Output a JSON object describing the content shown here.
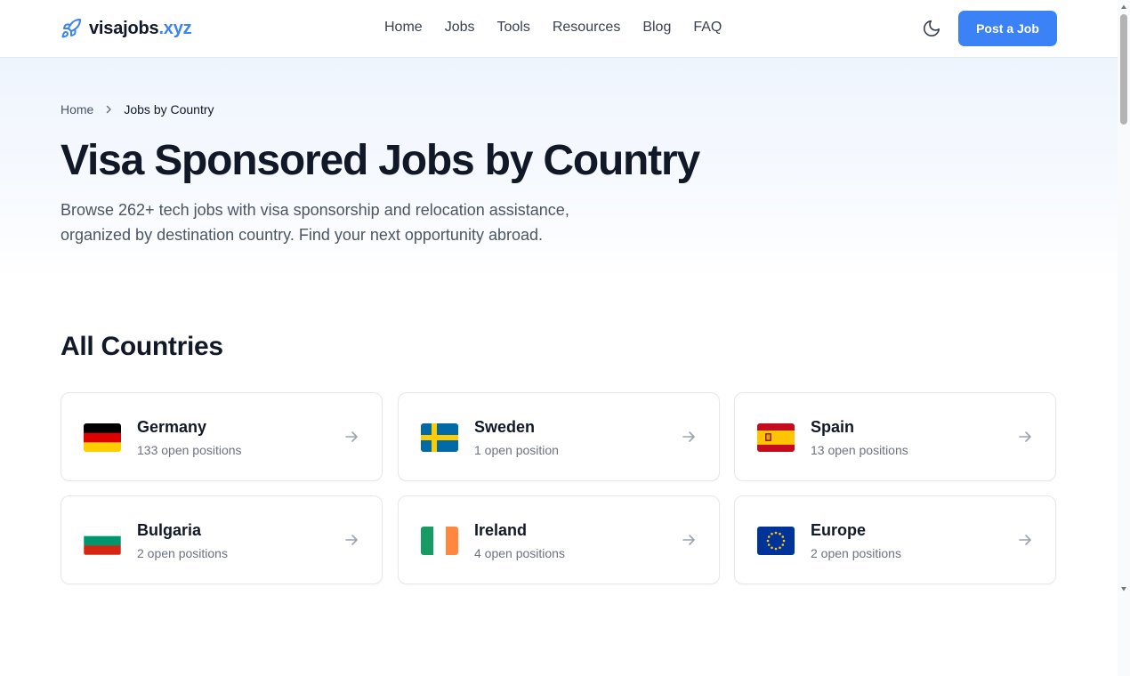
{
  "header": {
    "logo": {
      "brand": "visajobs",
      "tld": ".xyz",
      "icon": "rocket-icon",
      "color": "#3b82f6"
    },
    "nav": [
      "Home",
      "Jobs",
      "Tools",
      "Resources",
      "Blog",
      "FAQ"
    ],
    "theme_icon": "moon-icon",
    "post_job_label": "Post a Job"
  },
  "breadcrumb": {
    "home": "Home",
    "current": "Jobs by Country"
  },
  "hero": {
    "title": "Visa Sponsored Jobs by Country",
    "subtitle": "Browse 262+ tech jobs with visa sponsorship and relocation assistance, organized by destination country. Find your next opportunity abroad."
  },
  "section": {
    "title": "All Countries",
    "countries": [
      {
        "name": "Germany",
        "count": "133 open positions",
        "flag": "germany-flag"
      },
      {
        "name": "Sweden",
        "count": "1 open position",
        "flag": "sweden-flag"
      },
      {
        "name": "Spain",
        "count": "13 open positions",
        "flag": "spain-flag"
      },
      {
        "name": "Bulgaria",
        "count": "2 open positions",
        "flag": "bulgaria-flag"
      },
      {
        "name": "Ireland",
        "count": "4 open positions",
        "flag": "ireland-flag"
      },
      {
        "name": "Europe",
        "count": "2 open positions",
        "flag": "eu-flag"
      }
    ]
  },
  "colors": {
    "accent": "#3b82f6",
    "text": "#111827",
    "muted": "#6b7280",
    "border": "#e5e7eb"
  }
}
